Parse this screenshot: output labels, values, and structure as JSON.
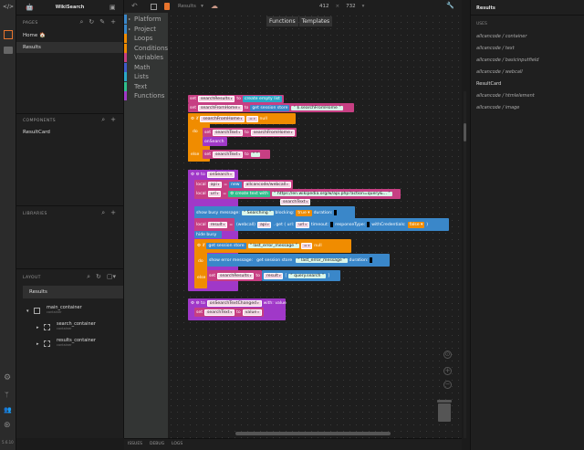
{
  "app": {
    "project_name": "WikiSearch",
    "version": "5.6.10"
  },
  "iconbar": {
    "icons": [
      "code-icon",
      "design-icon",
      "storage-icon",
      "settings-icon",
      "git-icon",
      "team-icon",
      "help-icon"
    ]
  },
  "pages": {
    "header": "PAGES",
    "items": [
      {
        "label": "Home 🏠"
      },
      {
        "label": "Results"
      }
    ],
    "selected": "Results"
  },
  "components": {
    "header": "COMPONENTS",
    "items": [
      {
        "label": "ResultCard"
      }
    ]
  },
  "libraries": {
    "header": "LIBRARIES"
  },
  "layout": {
    "header": "LAYOUT",
    "root": "Results",
    "tree": [
      {
        "label": "main_container",
        "type": "container"
      },
      {
        "label": "search_container",
        "type": "container"
      },
      {
        "label": "results_container",
        "type": "container"
      }
    ]
  },
  "toolbar": {
    "page_select": "Results",
    "width": "412",
    "times": "×",
    "height": "732"
  },
  "canvas_tabs": [
    "Functions",
    "Templates"
  ],
  "toolbox": {
    "categories": [
      {
        "label": "Platform",
        "color": "#3a87c9",
        "expandable": true
      },
      {
        "label": "Project",
        "color": "#3a87c9",
        "expandable": true
      },
      {
        "label": "Loops",
        "color": "#f08c00"
      },
      {
        "label": "Conditions",
        "color": "#f08c00"
      },
      {
        "label": "Variables",
        "color": "#c73f83"
      },
      {
        "label": "Math",
        "color": "#3f5bc9"
      },
      {
        "label": "Lists",
        "color": "#2aa9c9"
      },
      {
        "label": "Text",
        "color": "#2fbf8c"
      },
      {
        "label": "Functions",
        "color": "#a038c8"
      }
    ]
  },
  "block_colors": {
    "pink": "#c73f83",
    "orange": "#f08c00",
    "blue": "#3a87c9",
    "green": "#2fbf8c",
    "teal": "#2aa9c9",
    "purple": "#a038c8"
  },
  "blocks": [
    [
      {
        "k": "t",
        "v": "set"
      },
      {
        "k": "var",
        "v": "searchResults"
      },
      {
        "k": "t",
        "v": "to"
      },
      {
        "k": "blk",
        "c": "teal",
        "v": "create empty list"
      }
    ],
    [
      {
        "k": "t",
        "v": "set"
      },
      {
        "k": "var",
        "v": "searchFromHome"
      },
      {
        "k": "t",
        "v": "to"
      },
      {
        "k": "blk",
        "c": "blue",
        "v": "get session store"
      },
      {
        "k": "str",
        "v": "“ $.searchFromHome ”"
      }
    ],
    [
      {
        "k": "t",
        "v": "⚙ if"
      },
      {
        "k": "var",
        "v": "searchFromHome"
      },
      {
        "k": "var",
        "v": "="
      },
      {
        "k": "t",
        "v": "null"
      }
    ],
    [
      {
        "k": "t",
        "v": "do"
      }
    ],
    [
      {
        "k": "t",
        "v": "set"
      },
      {
        "k": "var",
        "v": "searchText"
      },
      {
        "k": "t",
        "v": "to"
      },
      {
        "k": "var",
        "v": "searchFromHome"
      }
    ],
    [
      {
        "k": "t",
        "v": "onSearch"
      }
    ],
    [
      {
        "k": "t",
        "v": "else"
      }
    ],
    [
      {
        "k": "t",
        "v": "set"
      },
      {
        "k": "var",
        "v": "searchText"
      },
      {
        "k": "t",
        "v": "to"
      },
      {
        "k": "str",
        "v": "“ ”"
      }
    ],
    [
      {
        "k": "t",
        "v": "⚙ ⚙ to"
      },
      {
        "k": "var",
        "v": "onSearch"
      }
    ],
    [
      {
        "k": "t",
        "v": "local"
      },
      {
        "k": "var",
        "v": "api"
      },
      {
        "k": "t",
        "v": "="
      },
      {
        "k": "blk",
        "c": "blue",
        "v": "new"
      },
      {
        "k": "var",
        "v": "allcancode/webcall"
      }
    ],
    [
      {
        "k": "t",
        "v": "local"
      },
      {
        "k": "var",
        "v": "url"
      },
      {
        "k": "t",
        "v": "="
      },
      {
        "k": "blk",
        "c": "green",
        "v": "⚙ create text with"
      },
      {
        "k": "str",
        "v": "“ https://en.wikipedia.org/w/api.php?action=query&... ”"
      }
    ],
    [
      {
        "k": "var",
        "v": "searchText"
      }
    ],
    [
      {
        "k": "t",
        "v": "show busy message:"
      },
      {
        "k": "str",
        "v": "“ Searching ”"
      },
      {
        "k": "t",
        "v": "blocking:"
      },
      {
        "k": "blk",
        "c": "orange",
        "v": "true ▾"
      },
      {
        "k": "t",
        "v": "duration:"
      },
      {
        "k": "hole"
      }
    ],
    [
      {
        "k": "t",
        "v": "local"
      },
      {
        "k": "var",
        "v": "result"
      },
      {
        "k": "t",
        "v": "="
      }
    ],
    [
      {
        "k": "t",
        "v": "(webcall)"
      },
      {
        "k": "var",
        "v": "api"
      },
      {
        "k": "t",
        "v": ". get ( url:"
      },
      {
        "k": "var",
        "v": "url"
      },
      {
        "k": "t",
        "v": "timeout:"
      },
      {
        "k": "hole"
      },
      {
        "k": "t",
        "v": "responseType:"
      },
      {
        "k": "hole"
      },
      {
        "k": "t",
        "v": "withCredentials:"
      },
      {
        "k": "blk",
        "c": "orange",
        "v": "false ▾"
      },
      {
        "k": "t",
        "v": ")"
      }
    ],
    [
      {
        "k": "t",
        "v": "hide busy"
      }
    ],
    [
      {
        "k": "t",
        "v": "⚙ if"
      },
      {
        "k": "blk",
        "c": "blue",
        "v": "get session store"
      },
      {
        "k": "str",
        "v": "“ last_error_message ”"
      },
      {
        "k": "var",
        "v": "="
      },
      {
        "k": "t",
        "v": "null"
      }
    ],
    [
      {
        "k": "t",
        "v": "do"
      }
    ],
    [
      {
        "k": "t",
        "v": "show error message:"
      },
      {
        "k": "blk",
        "c": "blue",
        "v": "get session store"
      },
      {
        "k": "str",
        "v": "“ last_error_message ”"
      },
      {
        "k": "t",
        "v": "duration:"
      },
      {
        "k": "hole"
      }
    ],
    [
      {
        "k": "t",
        "v": "else"
      }
    ],
    [
      {
        "k": "t",
        "v": "set"
      },
      {
        "k": "var",
        "v": "searchResults"
      },
      {
        "k": "t",
        "v": "to"
      }
    ],
    [
      {
        "k": "var",
        "v": "result"
      },
      {
        "k": "t",
        "v": "["
      },
      {
        "k": "str",
        "v": "“ query.search ”"
      },
      {
        "k": "t",
        "v": "]"
      }
    ],
    [
      {
        "k": "t",
        "v": "⚙ ⚙ to"
      },
      {
        "k": "var",
        "v": "onSearchTextChanged"
      },
      {
        "k": "t",
        "v": "with: value"
      }
    ],
    [
      {
        "k": "t",
        "v": "set"
      },
      {
        "k": "var",
        "v": "searchText"
      },
      {
        "k": "t",
        "v": "to"
      },
      {
        "k": "var",
        "v": "value"
      }
    ]
  ],
  "right_panel": {
    "title": "Results",
    "uses_header": "USES",
    "uses": [
      {
        "label": "allcancode / container",
        "italic": true
      },
      {
        "label": "allcancode / text",
        "italic": true
      },
      {
        "label": "allcancode / basicinputfield",
        "italic": true
      },
      {
        "label": "allcancode / webcall",
        "italic": true
      },
      {
        "label": "ResultCard",
        "italic": false
      },
      {
        "label": "allcancode / htmlelement",
        "italic": true
      },
      {
        "label": "allcancode / image",
        "italic": true
      }
    ]
  },
  "bottom_tabs": [
    "ISSUES",
    "DEBUG",
    "LOGS"
  ]
}
